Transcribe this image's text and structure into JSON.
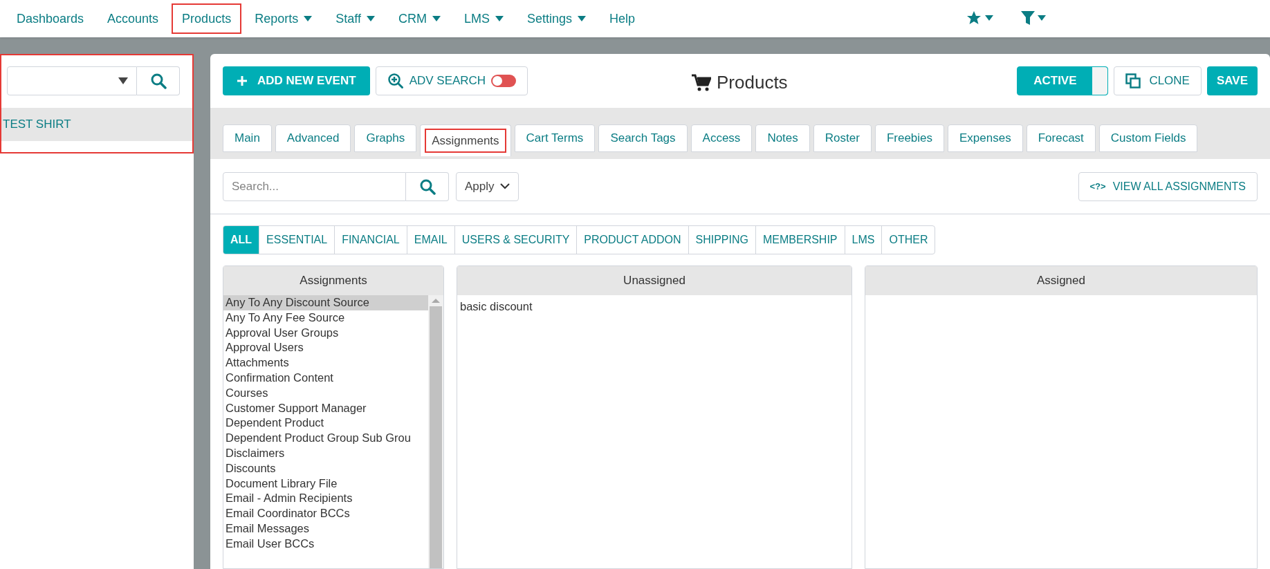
{
  "nav": {
    "items": [
      {
        "label": "Dashboards",
        "dropdown": false,
        "highlighted": false
      },
      {
        "label": "Accounts",
        "dropdown": false,
        "highlighted": false
      },
      {
        "label": "Products",
        "dropdown": false,
        "highlighted": true
      },
      {
        "label": "Reports",
        "dropdown": true,
        "highlighted": false
      },
      {
        "label": "Staff",
        "dropdown": true,
        "highlighted": false
      },
      {
        "label": "CRM",
        "dropdown": true,
        "highlighted": false
      },
      {
        "label": "LMS",
        "dropdown": true,
        "highlighted": false
      },
      {
        "label": "Settings",
        "dropdown": true,
        "highlighted": false
      },
      {
        "label": "Help",
        "dropdown": false,
        "highlighted": false
      }
    ]
  },
  "sidebar": {
    "highlighted": true,
    "items": [
      {
        "label": "TEST SHIRT",
        "selected": true
      }
    ]
  },
  "toolbar": {
    "add_button": "ADD NEW EVENT",
    "adv_search": {
      "label": "ADV SEARCH",
      "on": false
    },
    "title": "Products",
    "active_toggle": {
      "label": "ACTIVE",
      "on": true
    },
    "clone_button": "CLONE",
    "save_button": "SAVE"
  },
  "tabs": [
    {
      "label": "Main",
      "selected": false,
      "highlighted": false
    },
    {
      "label": "Advanced",
      "selected": false,
      "highlighted": false
    },
    {
      "label": "Graphs",
      "selected": false,
      "highlighted": false
    },
    {
      "label": "Assignments",
      "selected": true,
      "highlighted": true
    },
    {
      "label": "Cart Terms",
      "selected": false,
      "highlighted": false
    },
    {
      "label": "Search Tags",
      "selected": false,
      "highlighted": false
    },
    {
      "label": "Access",
      "selected": false,
      "highlighted": false
    },
    {
      "label": "Notes",
      "selected": false,
      "highlighted": false
    },
    {
      "label": "Roster",
      "selected": false,
      "highlighted": false
    },
    {
      "label": "Freebies",
      "selected": false,
      "highlighted": false
    },
    {
      "label": "Expenses",
      "selected": false,
      "highlighted": false
    },
    {
      "label": "Forecast",
      "selected": false,
      "highlighted": false
    },
    {
      "label": "Custom Fields",
      "selected": false,
      "highlighted": false
    }
  ],
  "search": {
    "placeholder": "Search...",
    "apply": "Apply",
    "view_all": "VIEW ALL ASSIGNMENTS",
    "view_all_icon": "<?>"
  },
  "categories": [
    {
      "label": "ALL",
      "selected": true
    },
    {
      "label": "ESSENTIAL",
      "selected": false
    },
    {
      "label": "FINANCIAL",
      "selected": false
    },
    {
      "label": "EMAIL",
      "selected": false
    },
    {
      "label": "USERS & SECURITY",
      "selected": false
    },
    {
      "label": "PRODUCT ADDON",
      "selected": false
    },
    {
      "label": "SHIPPING",
      "selected": false
    },
    {
      "label": "MEMBERSHIP",
      "selected": false
    },
    {
      "label": "LMS",
      "selected": false
    },
    {
      "label": "OTHER",
      "selected": false
    }
  ],
  "assignments": {
    "title": "Assignments",
    "items": [
      {
        "label": "Any To Any Discount Source",
        "selected": true
      },
      {
        "label": "Any To Any Fee Source",
        "selected": false
      },
      {
        "label": "Approval User Groups",
        "selected": false
      },
      {
        "label": "Approval Users",
        "selected": false
      },
      {
        "label": "Attachments",
        "selected": false
      },
      {
        "label": "Confirmation Content",
        "selected": false
      },
      {
        "label": "Courses",
        "selected": false
      },
      {
        "label": "Customer Support Manager",
        "selected": false
      },
      {
        "label": "Dependent Product",
        "selected": false
      },
      {
        "label": "Dependent Product Group Sub Grou",
        "selected": false
      },
      {
        "label": "Disclaimers",
        "selected": false
      },
      {
        "label": "Discounts",
        "selected": false
      },
      {
        "label": "Document Library File",
        "selected": false
      },
      {
        "label": "Email - Admin Recipients",
        "selected": false
      },
      {
        "label": "Email Coordinator BCCs",
        "selected": false
      },
      {
        "label": "Email Messages",
        "selected": false
      },
      {
        "label": "Email User BCCs",
        "selected": false
      }
    ]
  },
  "unassigned": {
    "title": "Unassigned",
    "items": [
      "basic discount"
    ]
  },
  "assigned": {
    "title": "Assigned"
  }
}
